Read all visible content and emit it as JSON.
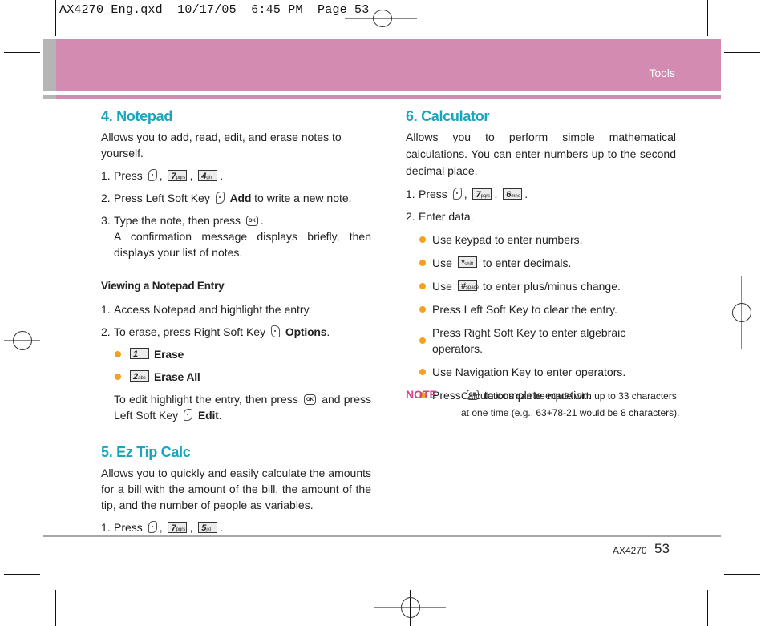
{
  "slug": "AX4270_Eng.qxd  10/17/05  6:45 PM  Page 53",
  "header": {
    "section": "Tools"
  },
  "colors": {
    "header_band": "#d38bb1",
    "heading": "#17a6bd",
    "bullet": "#f5a020",
    "note": "#d63f8a"
  },
  "notepad": {
    "title": "4. Notepad",
    "intro": "Allows you to add, read, edit, and erase notes to yourself.",
    "step1": {
      "num": "1.",
      "text": "Press",
      "keys": [
        "7",
        "4"
      ],
      "key_sub": [
        "pqrs",
        "ghi"
      ]
    },
    "step2": {
      "num": "2.",
      "pre": "Press Left Soft Key",
      "bold": "Add",
      "post": "to write a new note."
    },
    "step3": {
      "num": "3.",
      "pre": "Type the note, then press",
      "post": ".",
      "detail": "A confirmation message displays briefly, then displays your list of notes."
    },
    "viewing": {
      "title": "Viewing a Notepad Entry",
      "step1": {
        "num": "1.",
        "text": "Access Notepad and highlight the entry."
      },
      "step2": {
        "num": "2.",
        "pre": "To erase, press Right Soft Key",
        "bold": "Options",
        "post": "."
      },
      "options": [
        {
          "key": "1",
          "key_sub": "",
          "label": "Erase"
        },
        {
          "key": "2",
          "key_sub": "abc",
          "label": "Erase All"
        }
      ],
      "edit": {
        "pre": "To edit highlight the entry, then press",
        "mid": "and press Left Soft Key",
        "bold": "Edit",
        "post": "."
      }
    }
  },
  "tipcalc": {
    "title": "5. Ez Tip Calc",
    "intro": "Allows you to quickly and easily calculate the amounts for a bill with the amount of the bill, the amount of the tip, and the number of people as variables.",
    "step1": {
      "num": "1.",
      "text": "Press",
      "keys": [
        "7",
        "5"
      ],
      "key_sub": [
        "pqrs",
        "jkl"
      ]
    }
  },
  "calculator": {
    "title": "6. Calculator",
    "intro": "Allows you to perform simple mathematical calculations. You can enter numbers up to the second decimal place.",
    "step1": {
      "num": "1.",
      "text": "Press",
      "keys": [
        "7",
        "6"
      ],
      "key_sub": [
        "pqrs",
        "mno"
      ]
    },
    "step2": {
      "num": "2.",
      "text": "Enter data."
    },
    "bullets": [
      {
        "text": "Use keypad to enter numbers."
      },
      {
        "pre": "Use",
        "key": "*",
        "key_sub": "shift",
        "post": "to enter decimals."
      },
      {
        "pre": "Use",
        "key": "#",
        "key_sub": "space",
        "post": "to enter plus/minus change."
      },
      {
        "text": "Press Left Soft Key to clear the entry."
      },
      {
        "text": "Press Right Soft Key to enter algebraic operators."
      },
      {
        "text": "Use Navigation Key to enter operators."
      },
      {
        "pre": "Press",
        "post": "to complete equation."
      }
    ],
    "note": {
      "label": "NOTE",
      "line1": "Calculations can be made with up to 33 characters",
      "line2": "at one time (e.g., 63+78-21 would be 8 characters)."
    }
  },
  "footer": {
    "model": "AX4270",
    "page": "53"
  },
  "icons": {
    "soft_key": "soft-key-icon",
    "ok_key": "ok-key-icon",
    "ok_text": "OK"
  }
}
